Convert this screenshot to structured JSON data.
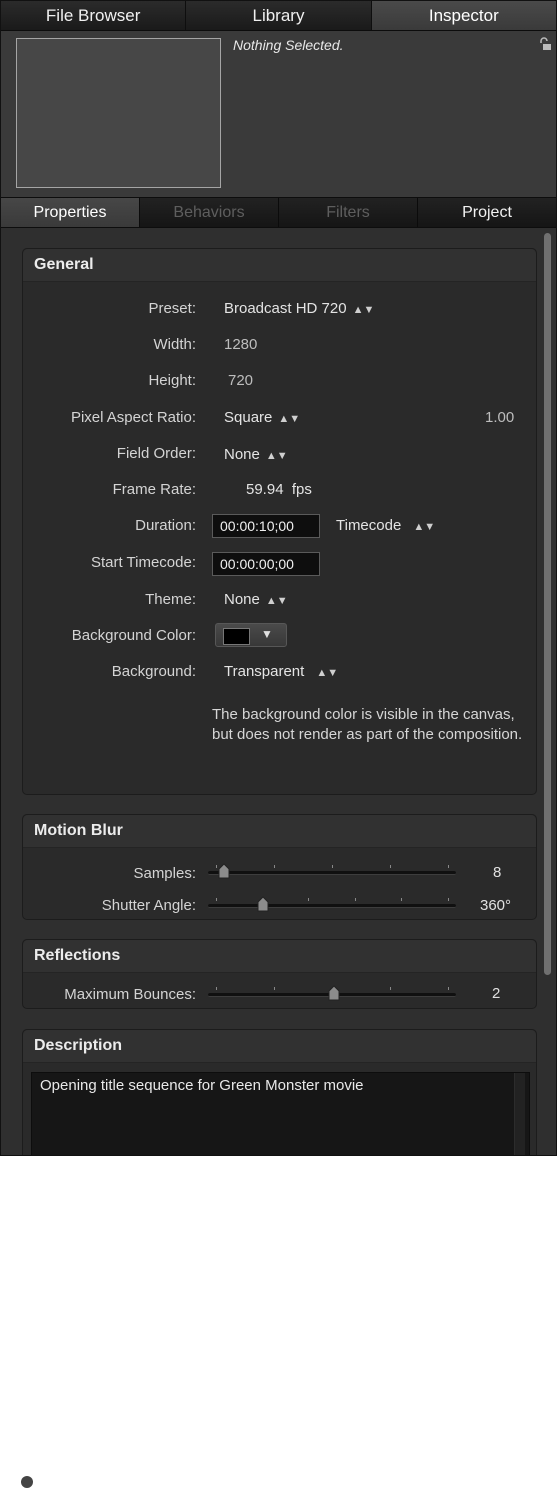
{
  "top_tabs": [
    "File Browser",
    "Library",
    "Inspector"
  ],
  "preview": {
    "status": "Nothing Selected."
  },
  "sub_tabs": [
    "Properties",
    "Behaviors",
    "Filters",
    "Project"
  ],
  "general": {
    "title": "General",
    "preset_label": "Preset:",
    "preset_value": "Broadcast HD 720",
    "width_label": "Width:",
    "width_value": "1280",
    "height_label": "Height:",
    "height_value": "720",
    "par_label": "Pixel Aspect Ratio:",
    "par_value": "Square",
    "par_number": "1.00",
    "field_order_label": "Field Order:",
    "field_order_value": "None",
    "frame_rate_label": "Frame Rate:",
    "frame_rate_value": "59.94",
    "frame_rate_unit": "fps",
    "duration_label": "Duration:",
    "duration_value": "00:00:10;00",
    "duration_format": "Timecode",
    "start_tc_label": "Start Timecode:",
    "start_tc_value": "00:00:00;00",
    "theme_label": "Theme:",
    "theme_value": "None",
    "bg_color_label": "Background Color:",
    "bg_color_value": "#000000",
    "background_label": "Background:",
    "background_value": "Transparent",
    "note": "The background color is visible in the canvas, but does not render as part of the composition."
  },
  "motion_blur": {
    "title": "Motion Blur",
    "samples_label": "Samples:",
    "samples_value": "8",
    "shutter_label": "Shutter Angle:",
    "shutter_value": "360°"
  },
  "reflections": {
    "title": "Reflections",
    "bounces_label": "Maximum Bounces:",
    "bounces_value": "2"
  },
  "description": {
    "title": "Description",
    "text": "Opening title sequence for Green Monster movie"
  }
}
